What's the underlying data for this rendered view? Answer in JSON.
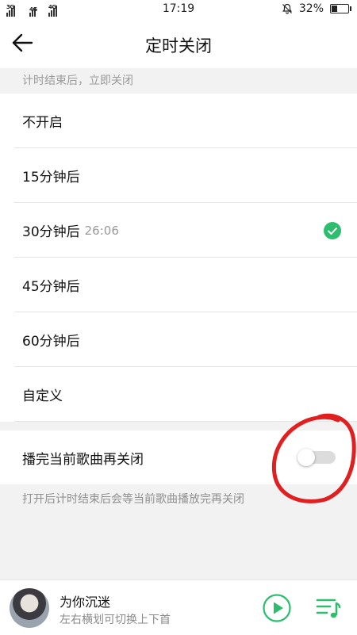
{
  "status_bar": {
    "network_1": "3G",
    "network_2": "4G",
    "network_3": "4G",
    "time": "17:19",
    "battery_percent_text": "32%",
    "battery_level": 0.32
  },
  "header": {
    "title": "定时关闭",
    "back_icon": "arrow-left-icon"
  },
  "hint_top": "计时结束后，立即关闭",
  "options": [
    {
      "label": "不开启",
      "countdown": "",
      "selected": false
    },
    {
      "label": "15分钟后",
      "countdown": "",
      "selected": false
    },
    {
      "label": "30分钟后",
      "countdown": "26:06",
      "selected": true
    },
    {
      "label": "45分钟后",
      "countdown": "",
      "selected": false
    },
    {
      "label": "60分钟后",
      "countdown": "",
      "selected": false
    },
    {
      "label": "自定义",
      "countdown": "",
      "selected": false
    }
  ],
  "toggle_row": {
    "label": "播完当前歌曲再关闭",
    "enabled": false
  },
  "hint_bottom": "打开后计时结束后会等当前歌曲播放完再关闭",
  "player": {
    "title": "为你沉迷",
    "subtitle": "左右横划可切换上下首",
    "play_icon": "play-icon",
    "playlist_icon": "playlist-icon"
  },
  "colors": {
    "accent_green": "#2dbd6e",
    "annotation_red": "#e02020"
  }
}
